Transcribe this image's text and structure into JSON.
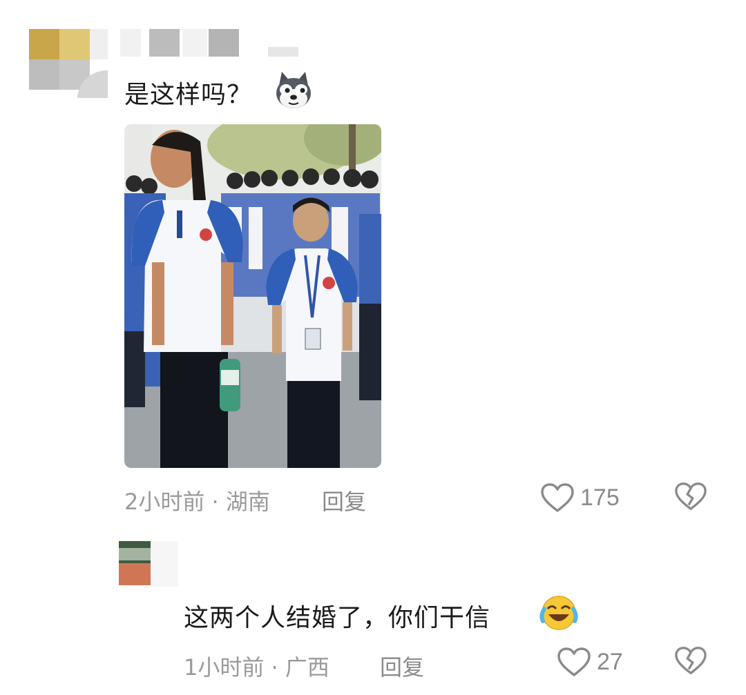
{
  "comments": [
    {
      "text": "是这样吗？",
      "emoji_icon": "husky-dog-emoji-icon",
      "has_image": true,
      "image_description_icon": "school-uniform-photo",
      "time": "2小时前",
      "location": "湖南",
      "time_location": "2小时前 · 湖南",
      "reply_label": "回复",
      "likes": "175"
    },
    {
      "text": "这两个人结婚了，你们干信",
      "emoji_icon": "laughing-crying-emoji-icon",
      "has_image": false,
      "time": "1小时前",
      "location": "广西",
      "time_location": "1小时前 · 广西",
      "reply_label": "回复",
      "likes": "27"
    }
  ],
  "colors": {
    "meta_text": "#9a9a9a",
    "uniform_blue": "#2f5fb8",
    "background": "#ffffff"
  }
}
